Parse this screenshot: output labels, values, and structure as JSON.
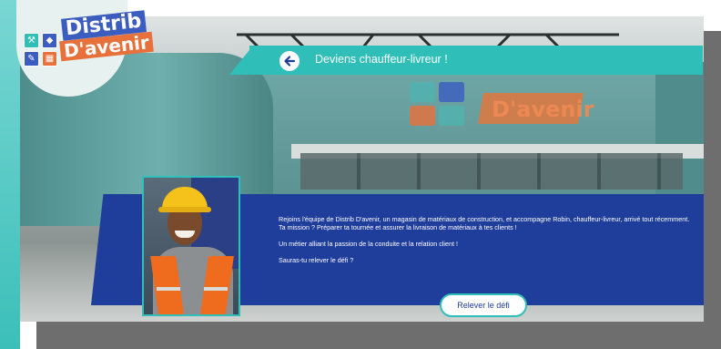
{
  "brand": {
    "line1": "Distrib",
    "line2": "D'avenir",
    "accent_teal": "#2fbfb8",
    "accent_blue": "#1f3d9a",
    "accent_orange": "#e8703a"
  },
  "header": {
    "title": "Deviens chauffeur-livreur !",
    "back_icon": "arrow-left-icon"
  },
  "intro": {
    "paragraph1": "Rejoins l'équipe de Distrib D'avenir, un magasin de matériaux de construction, et accompagne Robin, chauffeur-livreur, arrivé tout récemment.",
    "paragraph2": "Ta mission ? Préparer ta tournée et assurer la livraison de matériaux à tes clients !",
    "paragraph3": "Un métier alliant la passion de la conduite et la relation client !",
    "paragraph4": "Sauras-tu relever le défi ?"
  },
  "cta": {
    "label": "Relever le défi"
  },
  "store_sign": {
    "text": "D'avenir"
  }
}
